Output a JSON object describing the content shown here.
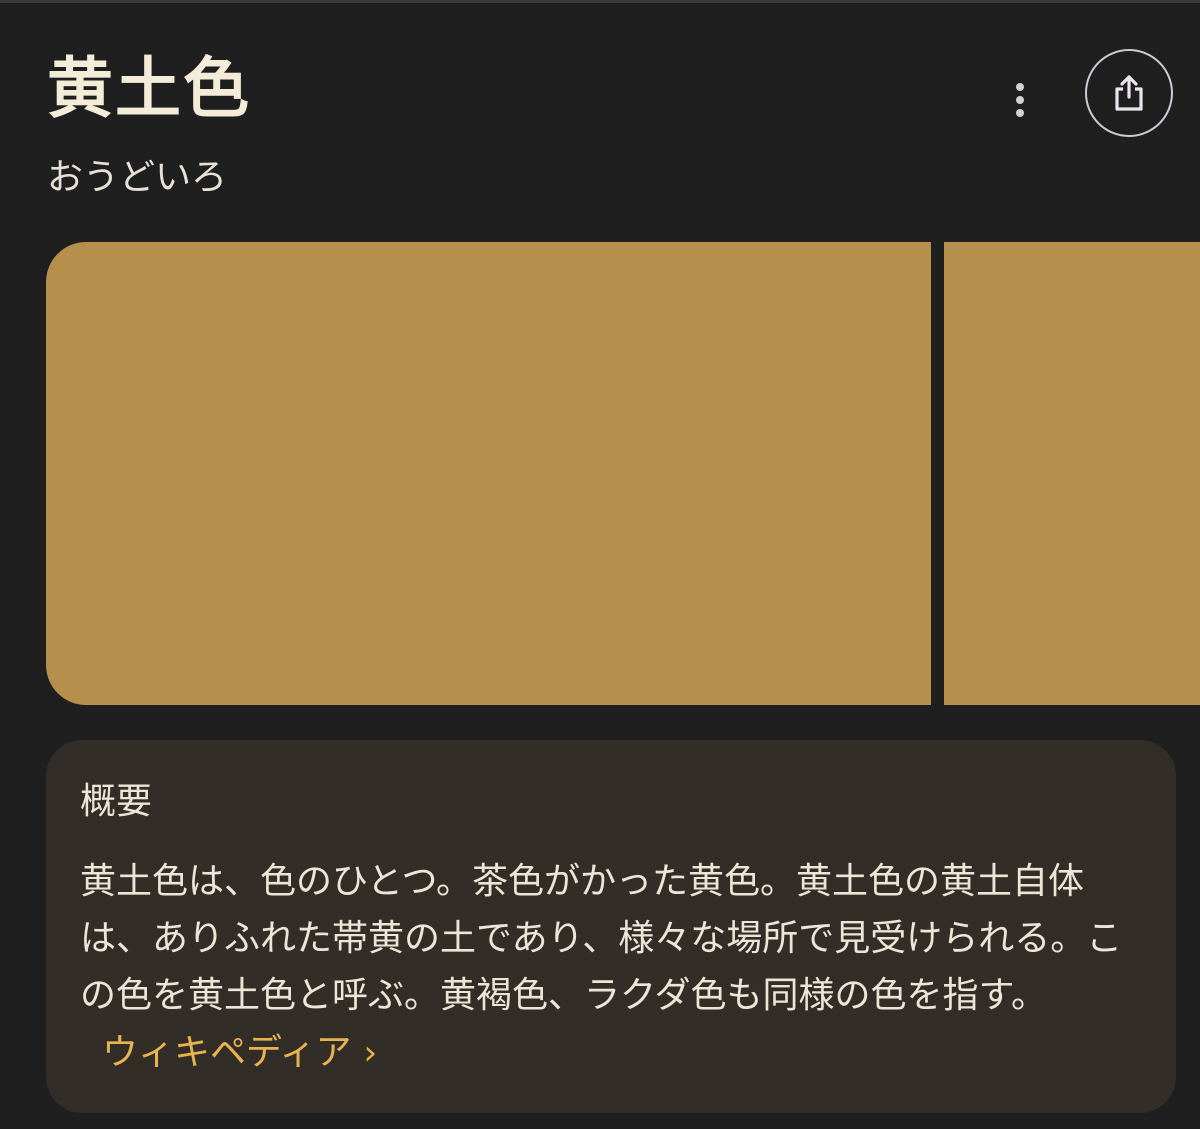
{
  "header": {
    "title": "黄土色",
    "reading": "おうどいろ"
  },
  "actions": {
    "more_icon": "more-vert-icon",
    "share_icon": "share-icon"
  },
  "swatch": {
    "color": "#b68f4d"
  },
  "summary": {
    "heading": "概要",
    "text": "黄土色は、色のひとつ。茶色がかった黄色。黄土色の黄土自体は、ありふれた帯黄の土であり、様々な場所で見受けられる。この色を黄土色と呼ぶ。黄褐色、ラクダ色も同様の色を指す。",
    "link_label": "ウィキペディア",
    "link_icon": "chevron-right-icon"
  },
  "colors": {
    "background": "#1f1f1f",
    "card": "#332d27",
    "link": "#e6b44f",
    "swatch": "#b68f4d"
  }
}
